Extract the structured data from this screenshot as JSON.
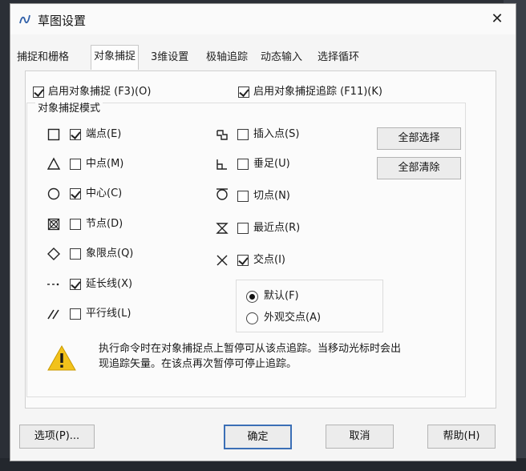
{
  "window": {
    "title": "草图设置",
    "close_glyph": "✕"
  },
  "tabs": [
    {
      "label": "捕捉和栅格",
      "active": false
    },
    {
      "label": "对象捕捉",
      "active": true
    },
    {
      "label": "3维设置",
      "active": false
    },
    {
      "label": "极轴追踪",
      "active": false
    },
    {
      "label": "动态输入",
      "active": false
    },
    {
      "label": "选择循环",
      "active": false
    }
  ],
  "top_options": {
    "snap_on": {
      "label": "启用对象捕捉 (F3)(O)",
      "checked": true
    },
    "tracking_on": {
      "label": "启用对象捕捉追踪 (F11)(K)",
      "checked": true
    }
  },
  "modes_group_title": "对象捕捉模式",
  "modes_left": [
    {
      "label": "端点(E)",
      "checked": true,
      "icon": "endpoint-square-icon"
    },
    {
      "label": "中点(M)",
      "checked": false,
      "icon": "midpoint-triangle-icon"
    },
    {
      "label": "中心(C)",
      "checked": true,
      "icon": "center-circle-icon"
    },
    {
      "label": "节点(D)",
      "checked": false,
      "icon": "node-crossed-square-icon"
    },
    {
      "label": "象限点(Q)",
      "checked": false,
      "icon": "quadrant-diamond-icon"
    },
    {
      "label": "延长线(X)",
      "checked": true,
      "icon": "extension-dashed-icon"
    },
    {
      "label": "平行线(L)",
      "checked": false,
      "icon": "parallel-lines-icon"
    }
  ],
  "modes_right": [
    {
      "label": "插入点(S)",
      "checked": false,
      "icon": "insertion-icon"
    },
    {
      "label": "垂足(U)",
      "checked": false,
      "icon": "perpendicular-icon"
    },
    {
      "label": "切点(N)",
      "checked": false,
      "icon": "tangent-icon"
    },
    {
      "label": "最近点(R)",
      "checked": false,
      "icon": "nearest-hourglass-icon"
    },
    {
      "label": "交点(I)",
      "checked": true,
      "icon": "intersection-x-icon"
    }
  ],
  "buttons_side": {
    "select_all": "全部选择",
    "clear_all": "全部清除"
  },
  "intersection_mode": [
    {
      "label": "默认(F)",
      "selected": true
    },
    {
      "label": "外观交点(A)",
      "selected": false
    }
  ],
  "hint": {
    "icon": "warning-triangle-icon",
    "line1": "执行命令时在对象捕捉点上暂停可从该点追踪。当移动光标时会出",
    "line2": "现追踪矢量。在该点再次暂停可停止追踪。"
  },
  "footer": {
    "options": "选项(P)...",
    "ok": "确定",
    "cancel": "取消",
    "help": "帮助(H)"
  },
  "colors": {
    "accent": "#3b6fb6",
    "warning": "#f2c21b",
    "background": "#f5f5f5"
  }
}
